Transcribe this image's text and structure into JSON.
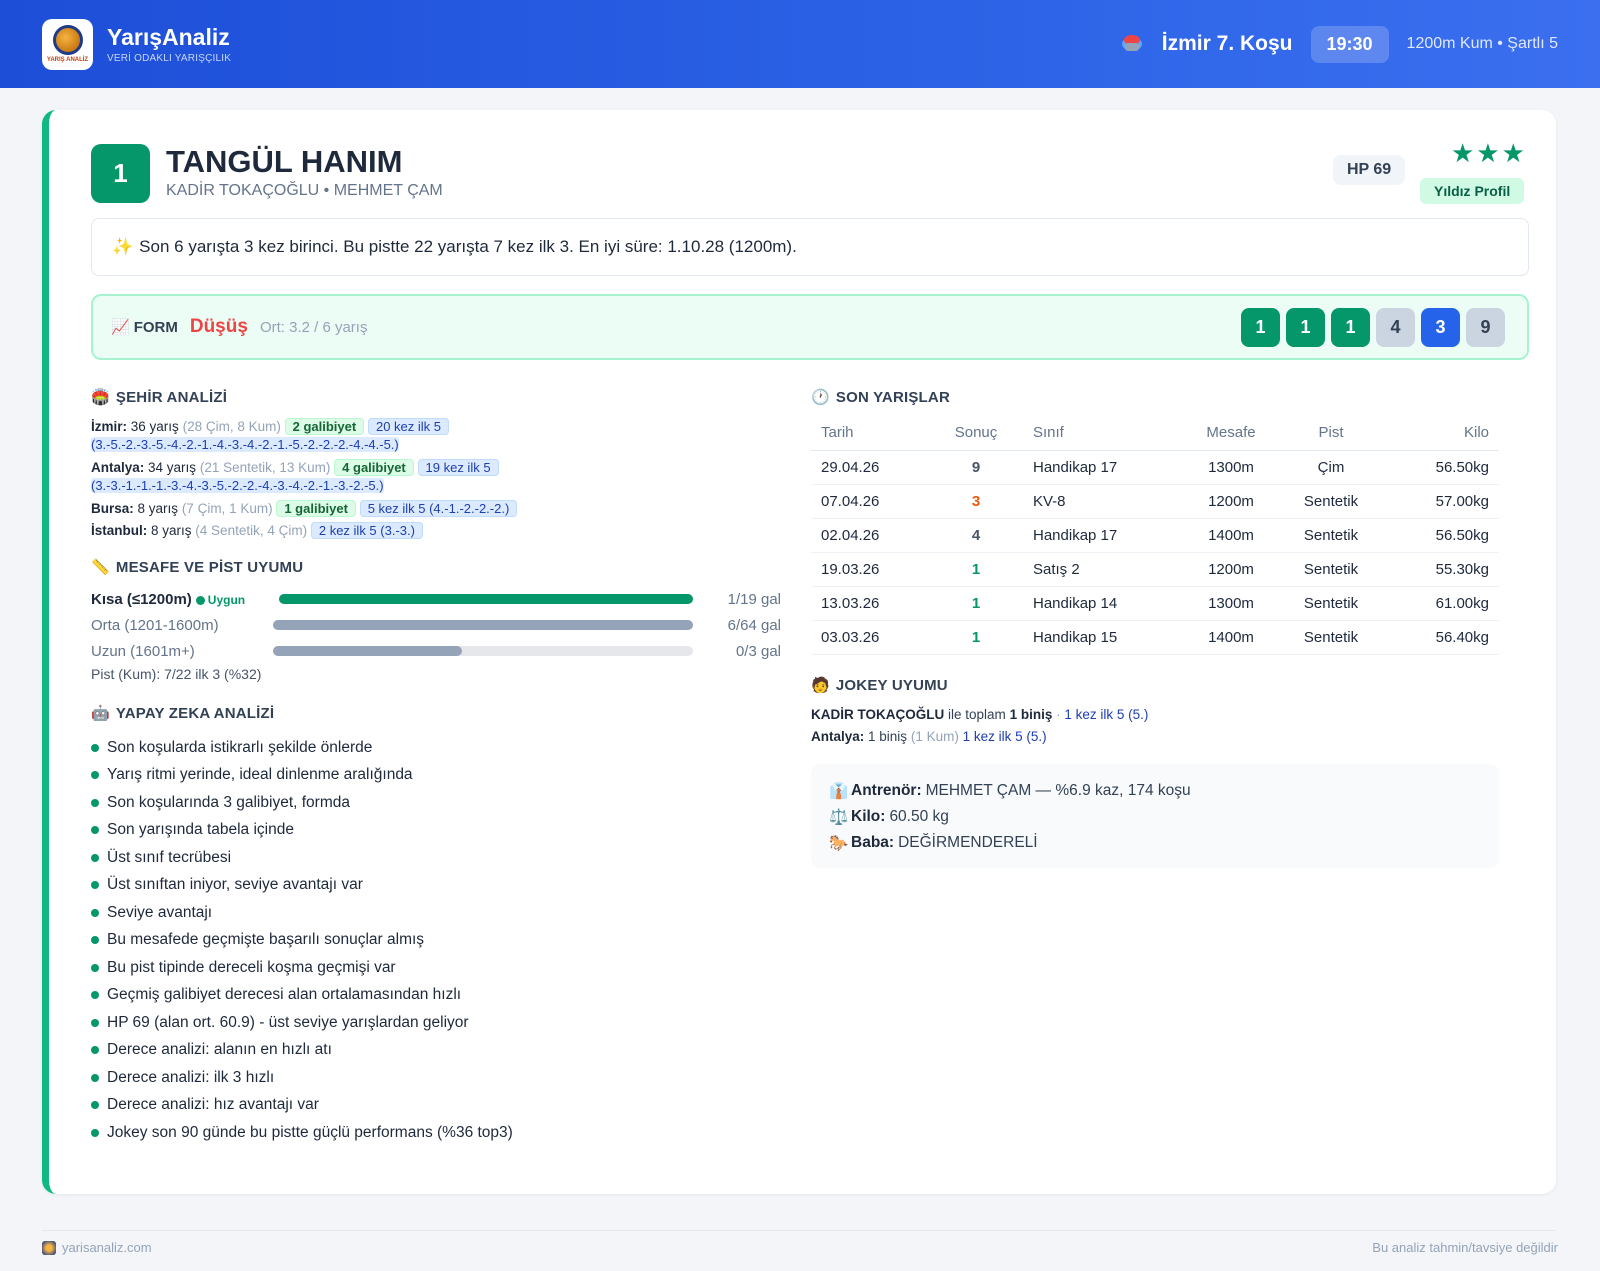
{
  "header": {
    "brand": "YarışAnaliz",
    "tagline": "VERİ ODAKLI YARIŞÇILIK",
    "logo_text": "YARIŞ ANALİZ",
    "race_title": "İzmir 7. Koşu",
    "race_time": "19:30",
    "race_meta": "1200m Kum • Şartlı 5",
    "race_icon": "horse-racing-icon"
  },
  "horse": {
    "number": "1",
    "name": "TANGÜL HANIM",
    "subtitle": "KADİR TOKAÇOĞLU • MEHMET ÇAM",
    "hp": "HP 69",
    "stars": "★★★",
    "star_label": "Yıldız Profil"
  },
  "summary": {
    "icon": "✨",
    "text": "Son 6 yarışta 3 kez birinci. Bu pistte 22 yarışta 7 kez ilk 3. En iyi süre: 1.10.28 (1200m)."
  },
  "form": {
    "icon": "📈",
    "label": "FORM",
    "trend": "Düşüş",
    "average": "Ort: 3.2 / 6 yarış",
    "results": [
      {
        "value": "1",
        "kind": "win"
      },
      {
        "value": "1",
        "kind": "win"
      },
      {
        "value": "1",
        "kind": "win"
      },
      {
        "value": "4",
        "kind": "other"
      },
      {
        "value": "3",
        "kind": "place"
      },
      {
        "value": "9",
        "kind": "other"
      }
    ]
  },
  "city": {
    "icon": "🏟️",
    "title": "ŞEHİR ANALİZİ",
    "rows": [
      {
        "city": "İzmir:",
        "races": "36 yarış",
        "detail": "(28 Çim, 8 Kum)",
        "wins": "2 galibiyet",
        "top5": "20 kez ilk 5",
        "seq": "(3.-5.-2.-3.-5.-4.-2.-1.-4.-3.-4.-2.-1.-5.-2.-2.-2.-4.-4.-5.)"
      },
      {
        "city": "Antalya:",
        "races": "34 yarış",
        "detail": "(21 Sentetik, 13 Kum)",
        "wins": "4 galibiyet",
        "top5": "19 kez ilk 5",
        "seq": "(3.-3.-1.-1.-1.-3.-4.-3.-5.-2.-2.-4.-3.-4.-2.-1.-3.-2.-5.)"
      },
      {
        "city": "Bursa:",
        "races": "8 yarış",
        "detail": "(7 Çim, 1 Kum)",
        "wins": "1 galibiyet",
        "top5": "5 kez ilk 5 (4.-1.-2.-2.-2.)",
        "seq": ""
      },
      {
        "city": "İstanbul:",
        "races": "8 yarış",
        "detail": "(4 Sentetik, 4 Çim)",
        "wins": "",
        "top5": "2 kez ilk 5 (3.-3.)",
        "seq": ""
      }
    ]
  },
  "distance": {
    "icon": "📏",
    "title": "MESAFE VE PİST UYUMU",
    "rows": [
      {
        "label": "Kısa (≤1200m)",
        "fit": "Uygun",
        "value": "1/19 gal",
        "fill": 1.0,
        "color": "#059669",
        "active": true
      },
      {
        "label": "Orta (1201-1600m)",
        "fit": "",
        "value": "6/64 gal",
        "fill": 1.0,
        "color": "#94a3b8",
        "active": false
      },
      {
        "label": "Uzun (1601m+)",
        "fit": "",
        "value": "0/3 gal",
        "fill": 0.45,
        "color": "#94a3b8",
        "active": false
      }
    ],
    "pist": "Pist (Kum): 7/22 ilk 3 (%32)"
  },
  "ai": {
    "icon": "🤖",
    "title": "YAPAY ZEKA ANALİZİ",
    "items": [
      "Son koşularda istikrarlı şekilde önlerde",
      "Yarış ritmi yerinde, ideal dinlenme aralığında",
      "Son koşularında 3 galibiyet, formda",
      "Son yarışında tabela içinde",
      "Üst sınıf tecrübesi",
      "Üst sınıftan iniyor, seviye avantajı var",
      "Seviye avantajı",
      "Bu mesafede geçmişte başarılı sonuçlar almış",
      "Bu pist tipinde dereceli koşma geçmişi var",
      "Geçmiş galibiyet derecesi alan ortalamasından hızlı",
      "HP 69 (alan ort. 60.9) - üst seviye yarışlardan geliyor",
      "Derece analizi: alanın en hızlı atı",
      "Derece analizi: ilk 3 hızlı",
      "Derece analizi: hız avantajı var",
      "Jokey son 90 günde bu pistte güçlü performans (%36 top3)"
    ]
  },
  "races": {
    "icon": "🕐",
    "title": "SON YARIŞLAR",
    "columns": [
      "Tarih",
      "Sonuç",
      "Sınıf",
      "Mesafe",
      "Pist",
      "Kilo"
    ],
    "rows": [
      {
        "date": "29.04.26",
        "result": "9",
        "kind": "px",
        "class": "Handikap 17",
        "distance": "1300m",
        "track": "Çim",
        "weight": "56.50kg"
      },
      {
        "date": "07.04.26",
        "result": "3",
        "kind": "p3",
        "class": "KV-8",
        "distance": "1200m",
        "track": "Sentetik",
        "weight": "57.00kg"
      },
      {
        "date": "02.04.26",
        "result": "4",
        "kind": "px",
        "class": "Handikap 17",
        "distance": "1400m",
        "track": "Sentetik",
        "weight": "56.50kg"
      },
      {
        "date": "19.03.26",
        "result": "1",
        "kind": "p1",
        "class": "Satış 2",
        "distance": "1200m",
        "track": "Sentetik",
        "weight": "55.30kg"
      },
      {
        "date": "13.03.26",
        "result": "1",
        "kind": "p1",
        "class": "Handikap 14",
        "distance": "1300m",
        "track": "Sentetik",
        "weight": "61.00kg"
      },
      {
        "date": "03.03.26",
        "result": "1",
        "kind": "p1",
        "class": "Handikap 15",
        "distance": "1400m",
        "track": "Sentetik",
        "weight": "56.40kg"
      }
    ]
  },
  "jockey": {
    "icon": "🧑",
    "title": "JOKEY UYUMU",
    "name": "KADİR TOKAÇOĞLU",
    "mid": "ile toplam",
    "rides": "1 biniş",
    "sep": "·",
    "top5": "1 kez ilk 5 (5.)",
    "city": "Antalya:",
    "city_rides": "1 biniş",
    "city_detail": "(1 Kum)",
    "city_top5": "1 kez ilk 5 (5.)"
  },
  "info": {
    "trainer_label": "Antrenör:",
    "trainer_value": "MEHMET ÇAM — %6.9 kaz, 174 koşu",
    "weight_label": "Kilo:",
    "weight_value": "60.50 kg",
    "sire_label": "Baba:",
    "sire_value": "DEĞİRMENDERELİ",
    "trainer_icon": "👔",
    "weight_icon": "⚖️",
    "sire_icon": "🐎"
  },
  "footer": {
    "site": "yarisanaliz.com",
    "disclaimer": "Bu analiz tahmin/tavsiye değildir"
  }
}
